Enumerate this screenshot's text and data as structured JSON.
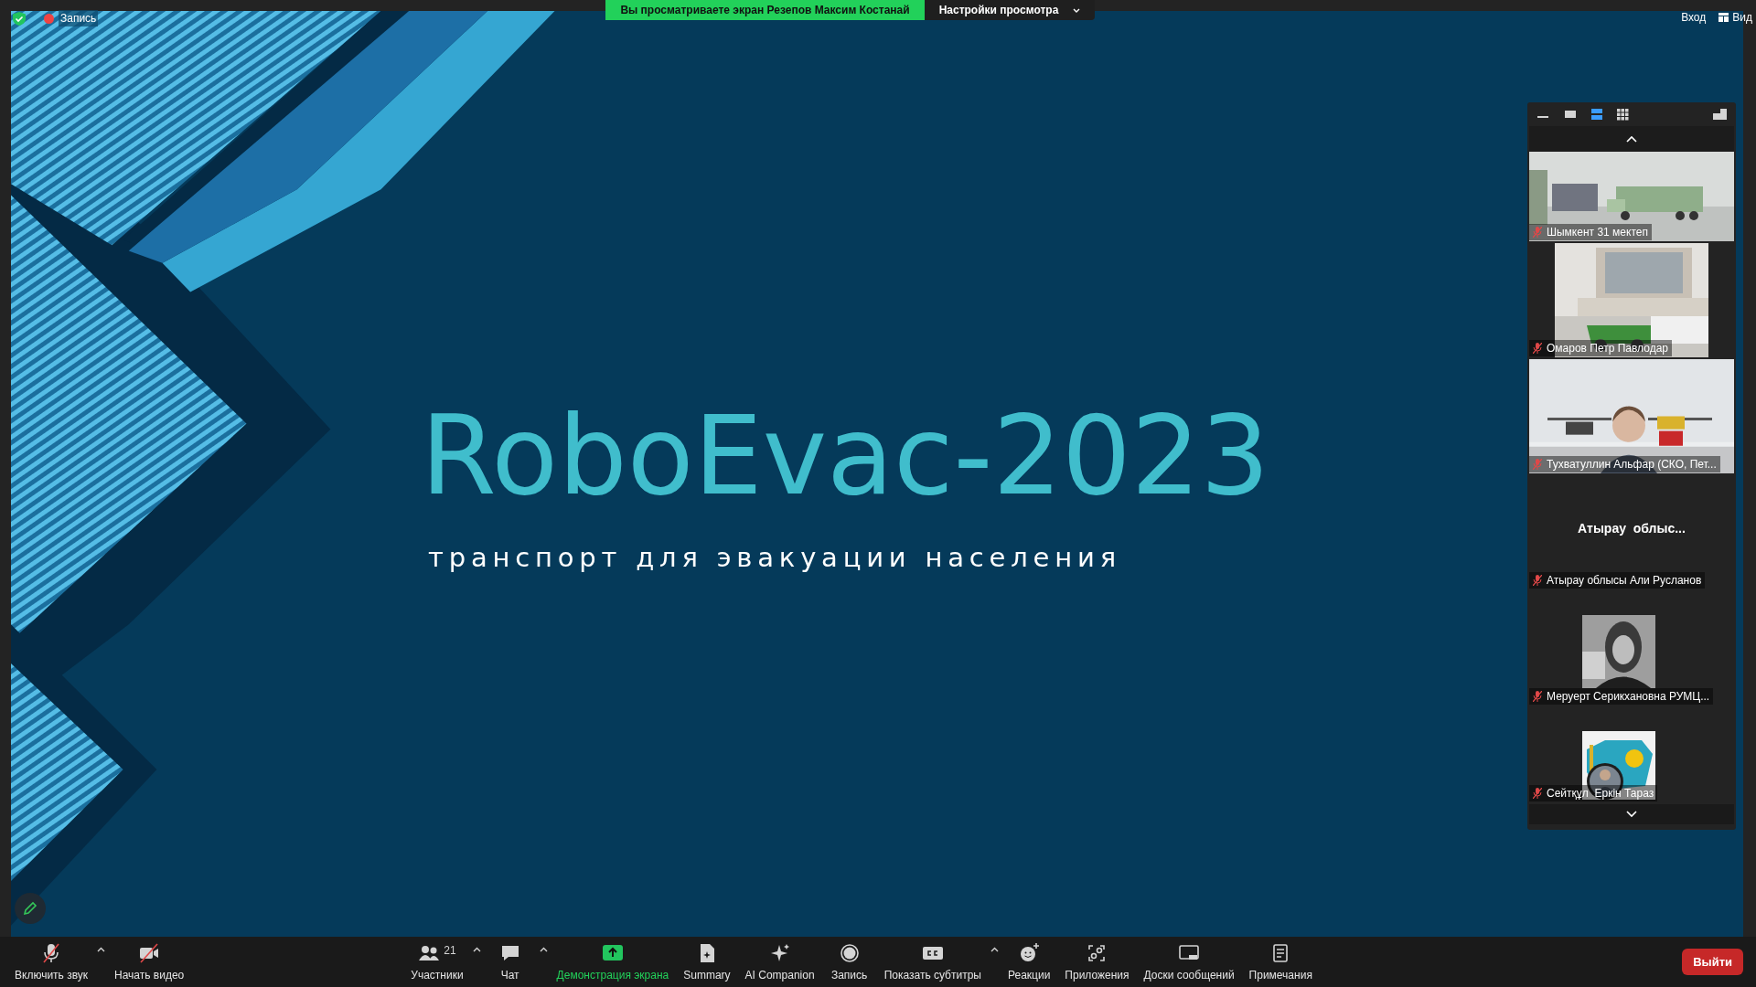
{
  "top_bar": {
    "recording_label": "Запись",
    "banner": "Вы просматриваете экран Резепов Максим Костанай",
    "view_settings": "Настройки просмотра",
    "login": "Вход",
    "view": "Вид"
  },
  "slide": {
    "title": "RoboEvac-2023",
    "subtitle": "транспорт для эвакуации населения"
  },
  "gallery": {
    "view_modes": [
      {
        "kind": "minimize",
        "selected": false
      },
      {
        "kind": "single",
        "selected": false
      },
      {
        "kind": "speaker",
        "selected": true
      },
      {
        "kind": "grid",
        "selected": false
      }
    ],
    "tiles": [
      {
        "kind": "wide",
        "name": "Шымкент 31 мектеп",
        "muted": true
      },
      {
        "kind": "narrow",
        "name": "Омаров Петр Павлодар",
        "muted": true
      },
      {
        "kind": "person",
        "name": "Тухватуллин Альфар (СКО, Пет...",
        "muted": true
      },
      {
        "kind": "name",
        "display": "Атырау  облыс...",
        "name": "Атырау облысы Али Русланов",
        "muted": true
      },
      {
        "name": "Меруерт Серикхановна РУМЦ...",
        "muted": true
      },
      {
        "kind": "flag",
        "name": "Сейтқұл  Еркін Тараз",
        "muted": true
      }
    ]
  },
  "toolbar": {
    "items": [
      {
        "kind": "mic",
        "label": "Включить звук",
        "caret": true
      },
      {
        "kind": "video",
        "label": "Начать видео",
        "caret": false
      },
      {
        "kind": "participants",
        "label": "Участники",
        "count": "21",
        "caret": true
      },
      {
        "kind": "chat",
        "label": "Чат",
        "caret": true
      },
      {
        "kind": "share",
        "label": "Демонстрация экрана",
        "caret": false
      },
      {
        "kind": "summary",
        "label": "Summary",
        "caret": false
      },
      {
        "kind": "ai",
        "label": "AI Companion",
        "caret": false
      },
      {
        "kind": "record",
        "label": "Запись",
        "caret": false
      },
      {
        "kind": "cc",
        "label": "Показать субтитры",
        "caret": true
      },
      {
        "kind": "reactions",
        "label": "Реакции",
        "caret": false
      },
      {
        "kind": "apps",
        "label": "Приложения",
        "caret": false
      },
      {
        "kind": "boards",
        "label": "Доски сообщений",
        "caret": false
      },
      {
        "kind": "notes",
        "label": "Примечания",
        "caret": false
      }
    ],
    "leave": "Выйти"
  }
}
